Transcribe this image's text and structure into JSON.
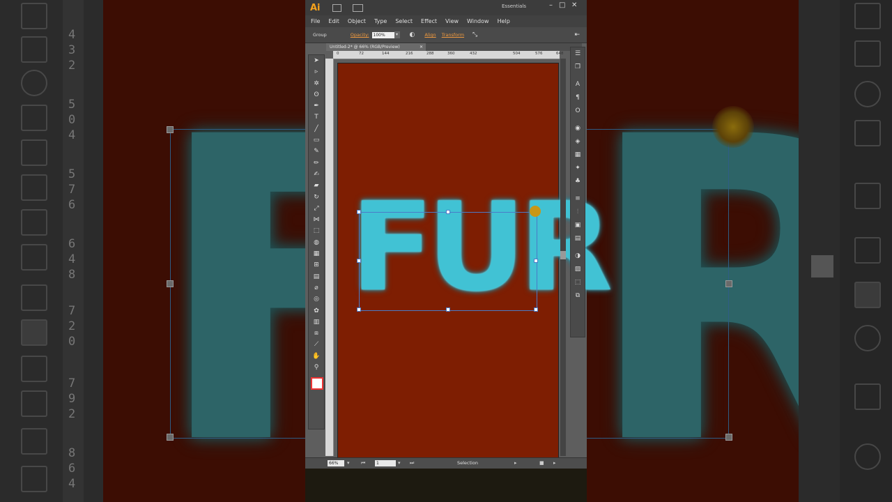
{
  "app": {
    "logo": "Ai",
    "workspace": "Essentials",
    "window_controls": [
      "–",
      "□",
      "✕"
    ]
  },
  "menu": [
    "File",
    "Edit",
    "Object",
    "Type",
    "Select",
    "Effect",
    "View",
    "Window",
    "Help"
  ],
  "control_bar": {
    "selection_type": "Group",
    "opacity_label": "Opacity:",
    "opacity_value": "100%",
    "align_label": "Align",
    "transform_label": "Transform"
  },
  "document": {
    "tab_title": "Untitled-2* @ 66% (RGB/Preview)",
    "tab_close": "✕",
    "ruler_ticks": [
      "0",
      "72",
      "144",
      "216",
      "288",
      "360",
      "432",
      "504",
      "576",
      "648"
    ],
    "artboard_color": "#7e1e02",
    "artwork_text": "FUR",
    "artwork_color": "#41c2d4"
  },
  "status_bar": {
    "zoom": "66%",
    "page": "1",
    "status_text": "Selection"
  },
  "background": {
    "ruler_digits_left": [
      "4",
      "3",
      "2",
      "5",
      "0",
      "4",
      "5",
      "7",
      "6",
      "6",
      "4",
      "8",
      "7",
      "2",
      "0",
      "7",
      "9",
      "2",
      "8",
      "6",
      "4"
    ],
    "glyph_left": "F",
    "glyph_right": "R"
  },
  "tools": [
    "selection-tool",
    "direct-selection-tool",
    "magic-wand-tool",
    "lasso-tool",
    "pen-tool",
    "type-tool",
    "line-tool",
    "rectangle-tool",
    "paintbrush-tool",
    "pencil-tool",
    "blob-brush-tool",
    "eraser-tool",
    "rotate-tool",
    "scale-tool",
    "width-tool",
    "free-transform-tool",
    "shape-builder-tool",
    "perspective-grid-tool",
    "mesh-tool",
    "gradient-tool",
    "eyedropper-tool",
    "blend-tool",
    "symbol-sprayer-tool",
    "column-graph-tool",
    "artboard-tool",
    "slice-tool",
    "hand-tool",
    "zoom-tool"
  ],
  "panels": [
    "layers-panel",
    "libraries-panel",
    "character-panel",
    "paragraph-panel",
    "opentype-panel",
    "appearance-panel",
    "graphic-styles-panel",
    "swatches-panel",
    "brushes-panel",
    "symbols-panel",
    "stroke-panel",
    "align-panel",
    "color-panel",
    "gradient-panel",
    "transparency-panel",
    "pathfinder-panel",
    "transform-panel",
    "links-panel"
  ]
}
